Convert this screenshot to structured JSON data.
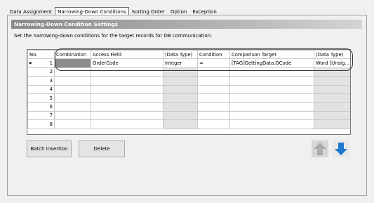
{
  "tabs": [
    {
      "label": "Data Assignment"
    },
    {
      "label": "Narrowing-Down Conditions"
    },
    {
      "label": "Sorting Order"
    },
    {
      "label": "Option"
    },
    {
      "label": "Exception"
    }
  ],
  "section": {
    "title": "Narrowing-Down Condition Settings",
    "description": "Set the narrowing-down conditions for the target records for DB communication."
  },
  "grid": {
    "headers": {
      "no": "No.",
      "combination": "Combination",
      "access_field": "Access Field",
      "data_type": "(Data Type)",
      "condition": "Condition",
      "comparison_target": "Comparison Target",
      "target_data_type": "(Data Type)"
    },
    "row_marker": "▶",
    "rows": [
      {
        "no": "1",
        "combination": "",
        "access_field": "OrderCode",
        "data_type": "Integer",
        "condition": "=",
        "comparison_target": "[TAG]GettingData.OCode",
        "target_data_type": "Word [Unsig..."
      },
      {
        "no": "2",
        "combination": "",
        "access_field": "",
        "data_type": "",
        "condition": "",
        "comparison_target": "",
        "target_data_type": ""
      },
      {
        "no": "3",
        "combination": "",
        "access_field": "",
        "data_type": "",
        "condition": "",
        "comparison_target": "",
        "target_data_type": ""
      },
      {
        "no": "4",
        "combination": "",
        "access_field": "",
        "data_type": "",
        "condition": "",
        "comparison_target": "",
        "target_data_type": ""
      },
      {
        "no": "5",
        "combination": "",
        "access_field": "",
        "data_type": "",
        "condition": "",
        "comparison_target": "",
        "target_data_type": ""
      },
      {
        "no": "6",
        "combination": "",
        "access_field": "",
        "data_type": "",
        "condition": "",
        "comparison_target": "",
        "target_data_type": ""
      },
      {
        "no": "7",
        "combination": "",
        "access_field": "",
        "data_type": "",
        "condition": "",
        "comparison_target": "",
        "target_data_type": ""
      },
      {
        "no": "8",
        "combination": "",
        "access_field": "",
        "data_type": "",
        "condition": "",
        "comparison_target": "",
        "target_data_type": ""
      }
    ]
  },
  "buttons": {
    "batch_insertion": "Batch Insertion",
    "delete": "Delete",
    "move_up_icon": "arrow-up-icon",
    "move_down_icon": "arrow-down-icon"
  },
  "colors": {
    "up_arrow": "#b8b8b8",
    "down_arrow": "#1e78d2",
    "highlight_outline": "#333333"
  }
}
